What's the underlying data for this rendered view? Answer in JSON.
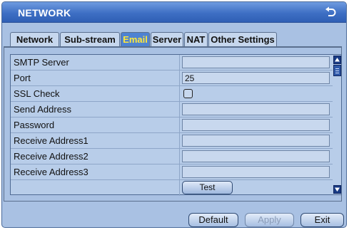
{
  "window": {
    "title": "NETWORK",
    "back_icon": "back-arrow-icon"
  },
  "tabs": [
    {
      "label": "Network",
      "active": false
    },
    {
      "label": "Sub-stream",
      "active": false
    },
    {
      "label": "Email",
      "active": true
    },
    {
      "label": "Server",
      "active": false
    },
    {
      "label": "NAT",
      "active": false
    },
    {
      "label": "Other Settings",
      "active": false
    }
  ],
  "form": {
    "rows": [
      {
        "label": "SMTP Server",
        "type": "text",
        "value": ""
      },
      {
        "label": "Port",
        "type": "text",
        "value": "25"
      },
      {
        "label": "SSL Check",
        "type": "checkbox",
        "checked": false
      },
      {
        "label": "Send Address",
        "type": "text",
        "value": ""
      },
      {
        "label": "Password",
        "type": "text",
        "value": ""
      },
      {
        "label": "Receive Address1",
        "type": "text",
        "value": ""
      },
      {
        "label": "Receive Address2",
        "type": "text",
        "value": ""
      },
      {
        "label": "Receive Address3",
        "type": "text",
        "value": ""
      },
      {
        "label": "",
        "type": "button",
        "button_label": "Test"
      }
    ]
  },
  "buttons": {
    "default": "Default",
    "apply": "Apply",
    "exit": "Exit"
  },
  "colors": {
    "title_bar": "#3e6fc4",
    "active_tab": "#4e82d2",
    "active_tab_text": "#ffe83a",
    "panel": "#a9c1e3"
  }
}
